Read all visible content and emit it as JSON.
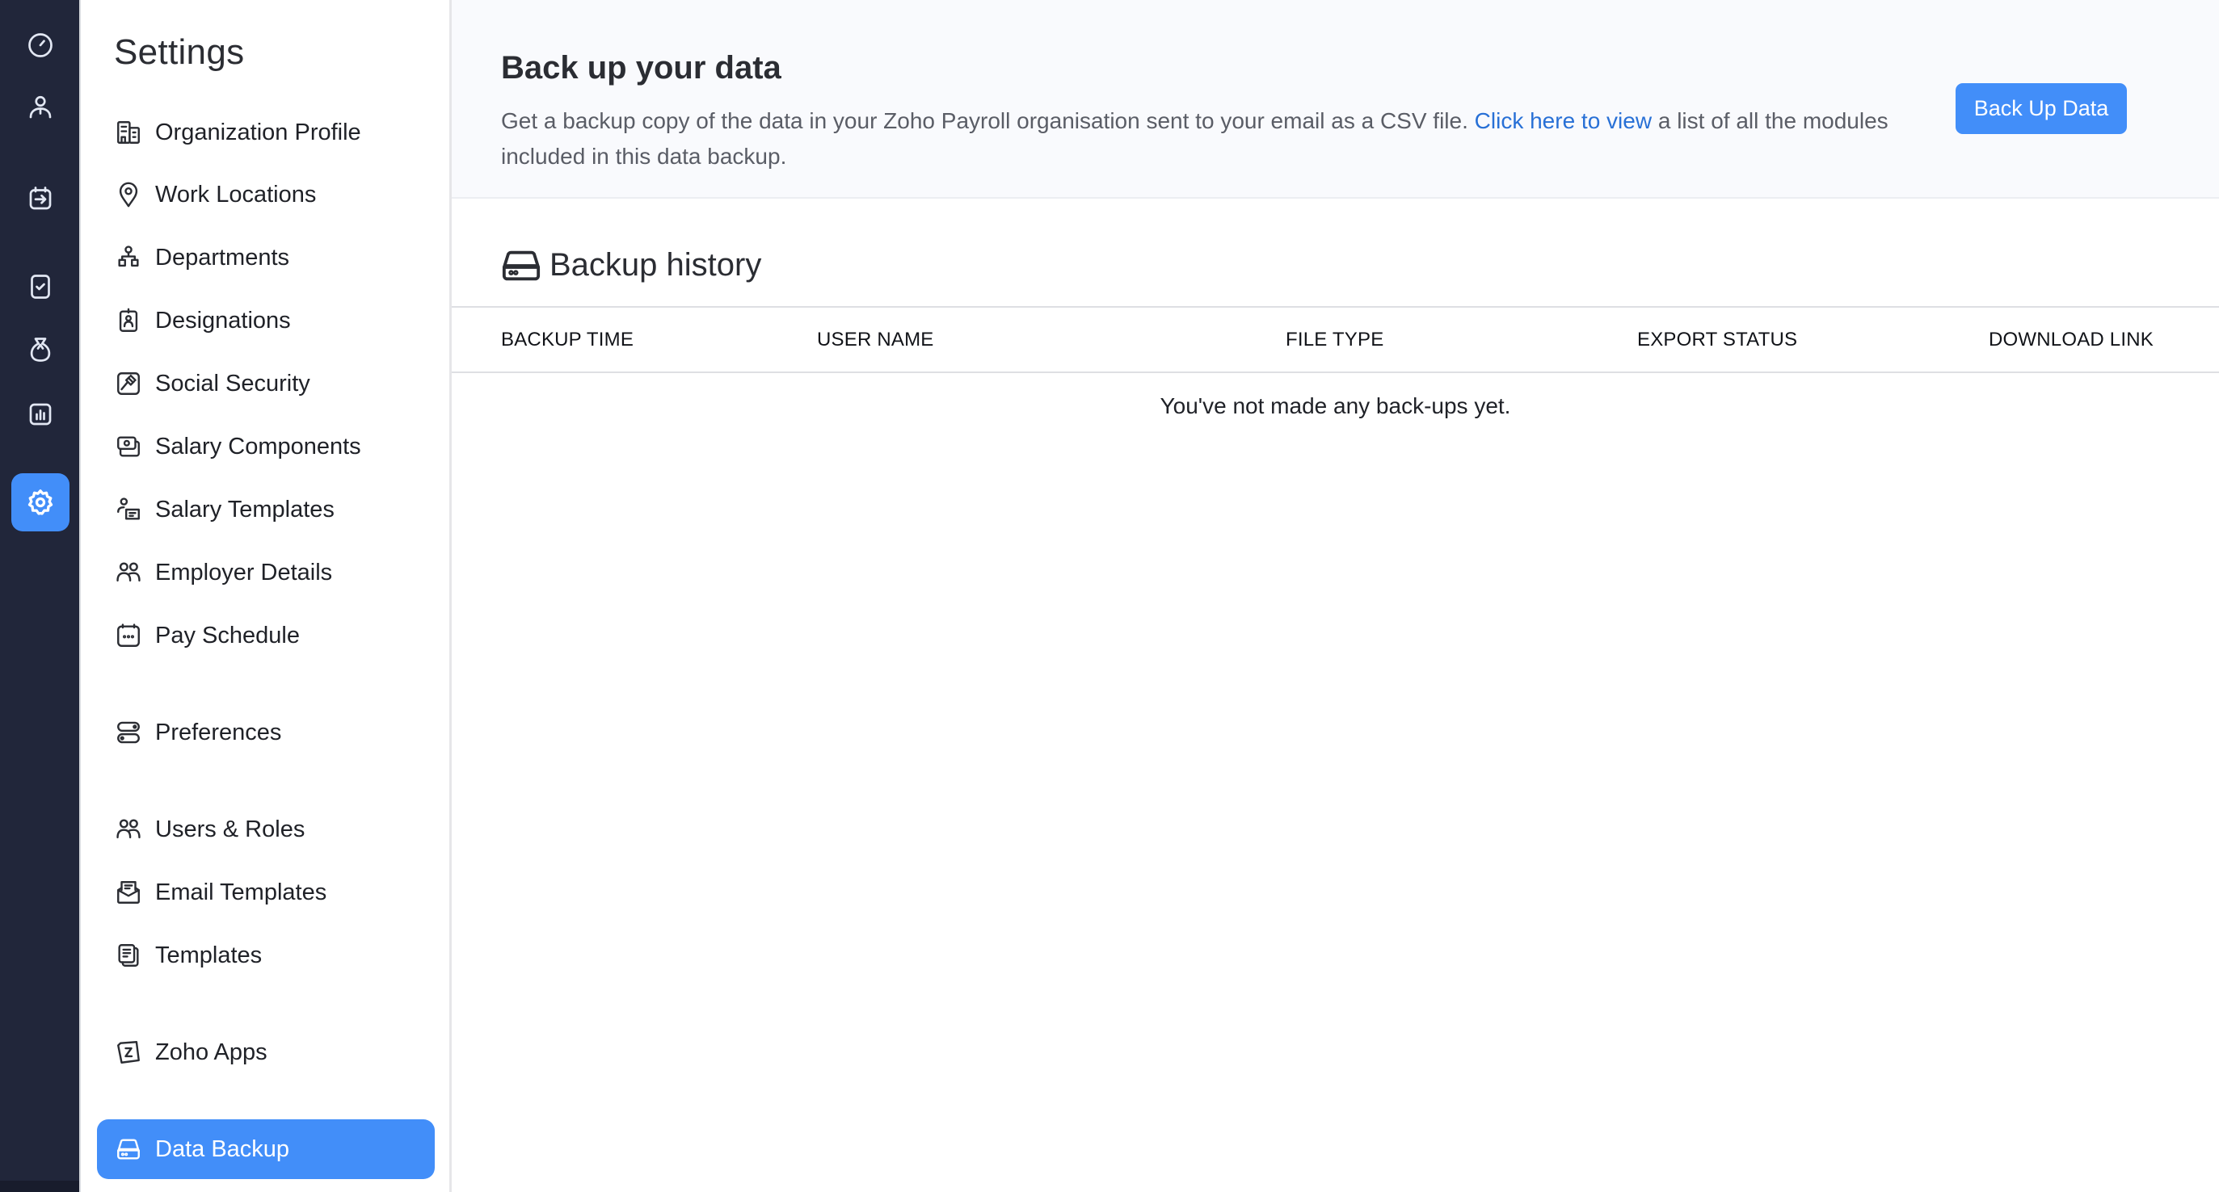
{
  "colors": {
    "rail_bg": "#21263a",
    "accent": "#428ef9",
    "link": "#2870d6",
    "hero_bg": "#f9fafd"
  },
  "rail": {
    "items": [
      {
        "name": "dashboard",
        "icon": "gauge-icon",
        "active": false
      },
      {
        "name": "employees",
        "icon": "person-icon",
        "active": false
      },
      {
        "name": "pay-runs",
        "icon": "calendar-arrow-icon",
        "active": false
      },
      {
        "name": "approvals",
        "icon": "clipboard-check-icon",
        "active": false
      },
      {
        "name": "benefits",
        "icon": "money-bag-icon",
        "active": false
      },
      {
        "name": "reports",
        "icon": "bar-chart-icon",
        "active": false
      },
      {
        "name": "settings",
        "icon": "gear-icon",
        "active": true
      }
    ]
  },
  "sidebar": {
    "title": "Settings",
    "items": [
      {
        "label": "Organization Profile",
        "icon": "building-icon"
      },
      {
        "label": "Work Locations",
        "icon": "map-pin-icon"
      },
      {
        "label": "Departments",
        "icon": "org-chart-icon"
      },
      {
        "label": "Designations",
        "icon": "id-badge-icon"
      },
      {
        "label": "Social Security",
        "icon": "gavel-icon"
      },
      {
        "label": "Salary Components",
        "icon": "cash-icon"
      },
      {
        "label": "Salary Templates",
        "icon": "person-document-icon"
      },
      {
        "label": "Employer Details",
        "icon": "users-icon"
      },
      {
        "label": "Pay Schedule",
        "icon": "calendar-dots-icon"
      },
      {
        "label": "Preferences",
        "icon": "toggles-icon"
      },
      {
        "label": "Users & Roles",
        "icon": "users-icon"
      },
      {
        "label": "Email Templates",
        "icon": "mail-open-icon"
      },
      {
        "label": "Templates",
        "icon": "documents-icon"
      },
      {
        "label": "Zoho Apps",
        "icon": "zoho-z-icon"
      },
      {
        "label": "Data Backup",
        "icon": "hard-drive-icon",
        "active": true
      }
    ]
  },
  "hero": {
    "title": "Back up your data",
    "desc_before": "Get a backup copy of the data in your Zoho Payroll organisation sent to your email as a CSV file. ",
    "desc_link": "Click here to view",
    "desc_after": " a list of all the modules included in this data backup.",
    "button_label": "Back Up Data"
  },
  "history": {
    "title": "Backup history",
    "columns": [
      "BACKUP TIME",
      "USER NAME",
      "FILE TYPE",
      "EXPORT STATUS",
      "DOWNLOAD LINK"
    ],
    "rows": [],
    "empty_message": "You've not made any back-ups yet."
  }
}
